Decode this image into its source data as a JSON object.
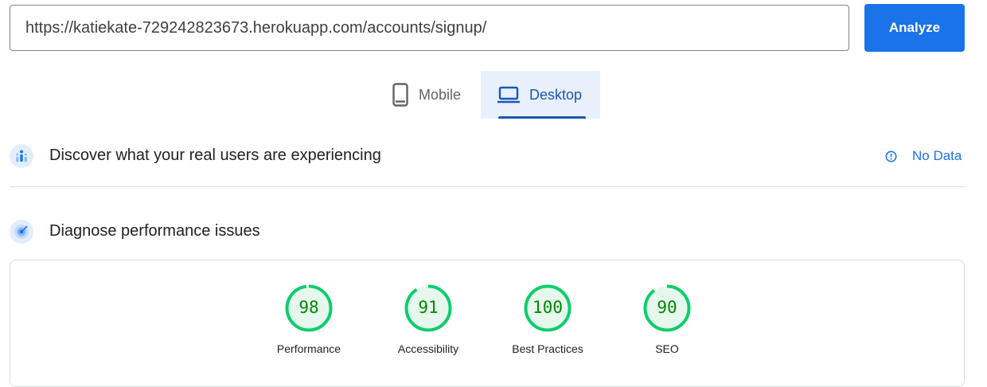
{
  "url_input": {
    "value": "https://katiekate-729242823673.herokuapp.com/accounts/signup/"
  },
  "analyze_button": {
    "label": "Analyze"
  },
  "device_tabs": [
    {
      "label": "Mobile",
      "icon": "smartphone-icon",
      "selected": false
    },
    {
      "label": "Desktop",
      "icon": "laptop-icon",
      "selected": true
    }
  ],
  "field_data": {
    "title": "Discover what your real users are experiencing",
    "status_label": "No Data",
    "status_icon": "info-icon"
  },
  "lab_data": {
    "title": "Diagnose performance issues",
    "scores": [
      {
        "value": "98",
        "label": "Performance",
        "fraction": 0.98
      },
      {
        "value": "91",
        "label": "Accessibility",
        "fraction": 0.91
      },
      {
        "value": "100",
        "label": "Best Practices",
        "fraction": 1.0
      },
      {
        "value": "90",
        "label": "SEO",
        "fraction": 0.9
      }
    ]
  },
  "colors": {
    "accent": "#1a73e8",
    "pass_green": "#0cce6b",
    "pass_fill": "#e6f8ed",
    "score_text": "#008800",
    "tab_selected_bg": "#e8f0fe"
  }
}
